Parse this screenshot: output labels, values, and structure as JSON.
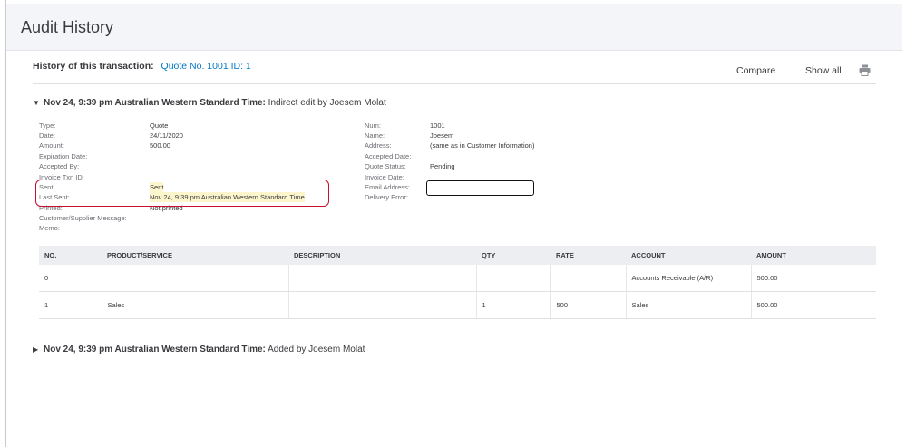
{
  "page": {
    "title": "Audit History"
  },
  "history": {
    "label": "History of this transaction:",
    "link": "Quote No. 1001 ID: 1",
    "compare": "Compare",
    "show_all": "Show all",
    "print_icon": "printer-icon"
  },
  "entries": [
    {
      "timestamp": "Nov 24, 9:39 pm Australian Western Standard Time:",
      "action": "Indirect edit by Joesem Molat",
      "expanded": true
    },
    {
      "timestamp": "Nov 24, 9:39 pm Australian Western Standard Time:",
      "action": "Added by Joesem Molat",
      "expanded": false
    }
  ],
  "details_left": [
    {
      "label": "Type:",
      "value": "Quote"
    },
    {
      "label": "Date:",
      "value": "24/11/2020"
    },
    {
      "label": "Amount:",
      "value": "500.00"
    },
    {
      "label": "Expiration Date:",
      "value": ""
    },
    {
      "label": "Accepted By:",
      "value": ""
    },
    {
      "label": "Invoice Txn ID:",
      "value": ""
    },
    {
      "label": "Sent:",
      "value": "Sent"
    },
    {
      "label": "Last Sent:",
      "value": "Nov 24, 9:39 pm Australian Western Standard Time"
    },
    {
      "label": "Printed:",
      "value": "Not printed"
    },
    {
      "label": "Customer/Supplier Message:",
      "value": ""
    },
    {
      "label": "Memo:",
      "value": ""
    }
  ],
  "details_right": [
    {
      "label": "Num:",
      "value": "1001"
    },
    {
      "label": "Name:",
      "value": "Joesem"
    },
    {
      "label": "Address:",
      "value": "(same as in Customer Information)"
    },
    {
      "label": "Accepted Date:",
      "value": ""
    },
    {
      "label": "Quote Status:",
      "value": "Pending"
    },
    {
      "label": "Invoice Date:",
      "value": ""
    },
    {
      "label": "Email Address:",
      "value": ""
    },
    {
      "label": "Delivery Error:",
      "value": ""
    }
  ],
  "table": {
    "headers": [
      "NO.",
      "PRODUCT/SERVICE",
      "DESCRIPTION",
      "QTY",
      "RATE",
      "ACCOUNT",
      "AMOUNT"
    ],
    "rows": [
      [
        "0",
        "",
        "",
        "",
        "",
        "Accounts Receivable (A/R)",
        "500.00"
      ],
      [
        "1",
        "Sales",
        "",
        "1",
        "500",
        "Sales",
        "500.00"
      ]
    ]
  },
  "colors": {
    "link": "#0077c5",
    "highlight": "#fdf6cc",
    "annotation_red": "#c8102e",
    "header_bg": "#f4f5f8"
  }
}
